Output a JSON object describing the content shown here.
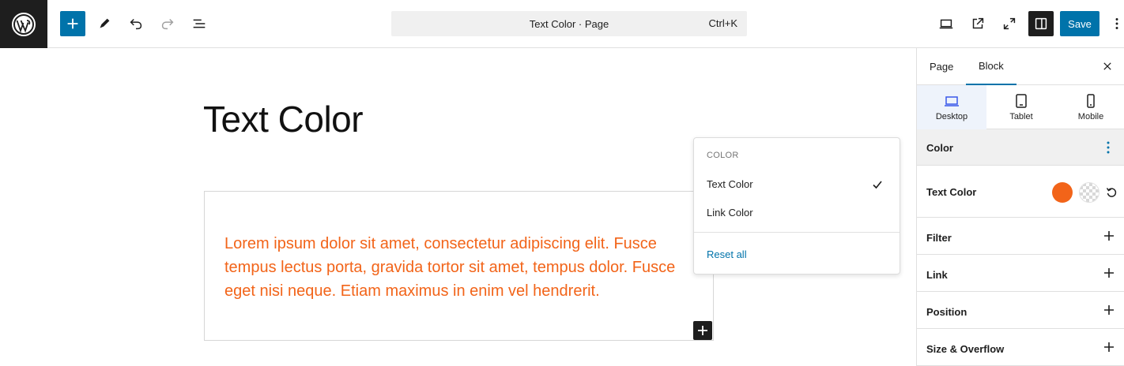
{
  "topbar": {
    "logo_icon": "wordpress-logo-icon",
    "command_title": "Text Color · Page",
    "shortcut": "Ctrl+K",
    "save_label": "Save",
    "accent": "#0073aa"
  },
  "canvas": {
    "title": "Text Color",
    "paragraph": "Lorem ipsum dolor sit amet, consectetur adipiscing elit. Fusce tempus lectus porta, gravida tortor sit amet, tempus dolor. Fusce eget nisi neque. Etiam maximus in enim vel hendrerit.",
    "text_color": "#f26419"
  },
  "popover": {
    "heading": "COLOR",
    "items": [
      {
        "label": "Text Color",
        "checked": true
      },
      {
        "label": "Link Color",
        "checked": false
      }
    ],
    "reset_label": "Reset all"
  },
  "sidebar": {
    "tabs": [
      {
        "label": "Page"
      },
      {
        "label": "Block",
        "active": true
      }
    ],
    "devices": [
      {
        "label": "Desktop",
        "icon": "desktop-icon",
        "active": true
      },
      {
        "label": "Tablet",
        "icon": "tablet-icon"
      },
      {
        "label": "Mobile",
        "icon": "mobile-icon"
      }
    ],
    "color_panel": {
      "title": "Color",
      "text_color_label": "Text Color",
      "swatch_color": "#f26419"
    },
    "sections": [
      {
        "label": "Filter"
      },
      {
        "label": "Link"
      },
      {
        "label": "Position"
      },
      {
        "label": "Size & Overflow"
      }
    ]
  }
}
